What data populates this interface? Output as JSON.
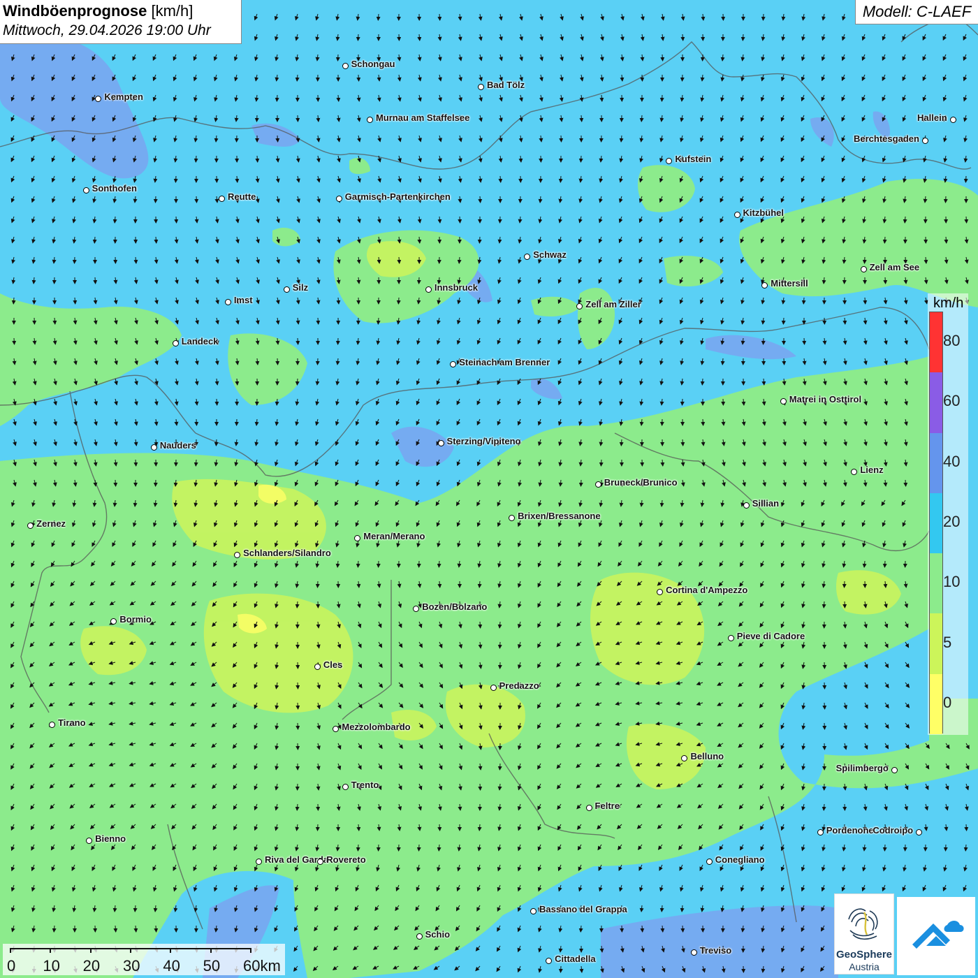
{
  "header": {
    "title_bold": "Windböenprognose",
    "title_unit": " [km/h]",
    "datetime": "Mittwoch, 29.04.2026 19:00 Uhr",
    "model": "Modell: C-LAEF"
  },
  "legend": {
    "unit": "km/h",
    "classes": [
      {
        "from": 0,
        "to": 5,
        "color": "#ffff66"
      },
      {
        "from": 5,
        "to": 10,
        "color": "#ccf55a"
      },
      {
        "from": 10,
        "to": 20,
        "color": "#8ceb8c"
      },
      {
        "from": 20,
        "to": 40,
        "color": "#33c8f0"
      },
      {
        "from": 40,
        "to": 60,
        "color": "#6495ed"
      },
      {
        "from": 60,
        "to": 80,
        "color": "#8a5ce6"
      },
      {
        "from": 80,
        "to": 100,
        "color": "#ff3333"
      }
    ],
    "tick_labels": [
      "0",
      "5",
      "10",
      "20",
      "40",
      "60",
      "80"
    ]
  },
  "scalebar": {
    "labels": [
      "0",
      "10",
      "20",
      "30",
      "40",
      "50",
      "60km"
    ]
  },
  "branding": {
    "geosphere_line1": "GeoSphere",
    "geosphere_line2": "Austria"
  },
  "cities": [
    {
      "name": "Schongau",
      "x": 11.12,
      "y": 47.81
    },
    {
      "name": "Bad Tölz",
      "x": 11.56,
      "y": 47.76
    },
    {
      "name": "Kempten",
      "x": 10.32,
      "y": 47.73
    },
    {
      "name": "Murnau am Staffelsee",
      "x": 11.2,
      "y": 47.68
    },
    {
      "name": "Hallein",
      "x": 13.09,
      "y": 47.68
    },
    {
      "name": "Berchtesgaden",
      "x": 13.0,
      "y": 47.63
    },
    {
      "name": "Kufstein",
      "x": 12.17,
      "y": 47.58
    },
    {
      "name": "Sonthofen",
      "x": 10.28,
      "y": 47.51
    },
    {
      "name": "Reutte",
      "x": 10.72,
      "y": 47.49
    },
    {
      "name": "Garmisch-Partenkirchen",
      "x": 11.1,
      "y": 47.49
    },
    {
      "name": "Kitzbühel",
      "x": 12.39,
      "y": 47.45
    },
    {
      "name": "Schwaz",
      "x": 11.71,
      "y": 47.35
    },
    {
      "name": "Zell am See",
      "x": 12.8,
      "y": 47.32
    },
    {
      "name": "Mittersill",
      "x": 12.48,
      "y": 47.28
    },
    {
      "name": "Innsbruck",
      "x": 11.39,
      "y": 47.27
    },
    {
      "name": "Silz",
      "x": 10.93,
      "y": 47.27
    },
    {
      "name": "Imst",
      "x": 10.74,
      "y": 47.24
    },
    {
      "name": "Zell am Ziller",
      "x": 11.88,
      "y": 47.23
    },
    {
      "name": "Landeck",
      "x": 10.57,
      "y": 47.14
    },
    {
      "name": "Steinach am Brenner",
      "x": 11.47,
      "y": 47.09
    },
    {
      "name": "Matrei in Osttirol",
      "x": 12.54,
      "y": 47.0
    },
    {
      "name": "Nauders",
      "x": 10.5,
      "y": 46.89
    },
    {
      "name": "Sterzing/Vipiteno",
      "x": 11.43,
      "y": 46.9
    },
    {
      "name": "Lienz",
      "x": 12.77,
      "y": 46.83
    },
    {
      "name": "Bruneck/Brunico",
      "x": 11.94,
      "y": 46.8
    },
    {
      "name": "Sillian",
      "x": 12.42,
      "y": 46.75
    },
    {
      "name": "Brixen/Bressanone",
      "x": 11.66,
      "y": 46.72
    },
    {
      "name": "Zernez",
      "x": 10.1,
      "y": 46.7
    },
    {
      "name": "Meran/Merano",
      "x": 11.16,
      "y": 46.67
    },
    {
      "name": "Schlanders/Silandro",
      "x": 10.77,
      "y": 46.63
    },
    {
      "name": "Cortina d'Ampezzo",
      "x": 12.14,
      "y": 46.54
    },
    {
      "name": "Bozen/Bolzano",
      "x": 11.35,
      "y": 46.5
    },
    {
      "name": "Bormio",
      "x": 10.37,
      "y": 46.47
    },
    {
      "name": "Pieve di Cadore",
      "x": 12.37,
      "y": 46.43
    },
    {
      "name": "Cles",
      "x": 11.03,
      "y": 46.36
    },
    {
      "name": "Predazzo",
      "x": 11.6,
      "y": 46.31
    },
    {
      "name": "Tirano",
      "x": 10.17,
      "y": 46.22
    },
    {
      "name": "Mezzolombardo",
      "x": 11.09,
      "y": 46.21
    },
    {
      "name": "Belluno",
      "x": 12.22,
      "y": 46.14
    },
    {
      "name": "Spilimbergo",
      "x": 12.9,
      "y": 46.11
    },
    {
      "name": "Trento",
      "x": 11.12,
      "y": 46.07
    },
    {
      "name": "Feltre",
      "x": 11.91,
      "y": 46.02
    },
    {
      "name": "Bienno",
      "x": 10.29,
      "y": 45.94
    },
    {
      "name": "Pordenone",
      "x": 12.66,
      "y": 45.96
    },
    {
      "name": "Codroipo",
      "x": 12.98,
      "y": 45.96
    },
    {
      "name": "Riva del Garda",
      "x": 10.84,
      "y": 45.89
    },
    {
      "name": "Rovereto",
      "x": 11.04,
      "y": 45.89
    },
    {
      "name": "Conegliano",
      "x": 12.3,
      "y": 45.89
    },
    {
      "name": "Bassano del Grappa",
      "x": 11.73,
      "y": 45.77
    },
    {
      "name": "Schio",
      "x": 11.36,
      "y": 45.71
    },
    {
      "name": "Treviso",
      "x": 12.25,
      "y": 45.67
    },
    {
      "name": "Cittadella",
      "x": 11.78,
      "y": 45.65
    }
  ]
}
